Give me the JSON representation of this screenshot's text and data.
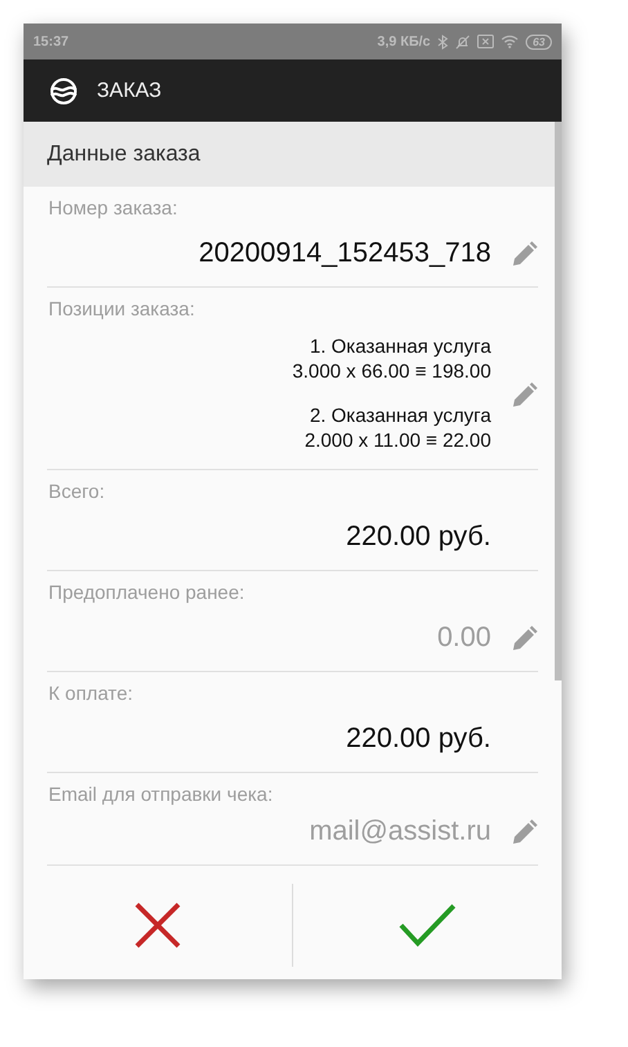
{
  "status_bar": {
    "time": "15:37",
    "speed": "3,9 КБ/с",
    "battery": "63"
  },
  "app_bar": {
    "title": "ЗАКАЗ"
  },
  "section": {
    "title": "Данные заказа"
  },
  "order_number": {
    "label": "Номер заказа:",
    "value": "20200914_152453_718",
    "editable": true
  },
  "positions": {
    "label": "Позиции заказа:",
    "items": [
      {
        "name": "1. Оказанная услуга",
        "calc": "3.000 x 66.00 ≡ 198.00"
      },
      {
        "name": "2. Оказанная услуга",
        "calc": "2.000 x 11.00 ≡ 22.00"
      }
    ],
    "editable": true
  },
  "fields": [
    {
      "label": "Всего:",
      "value": "220.00 руб.",
      "editable": false,
      "muted": false
    },
    {
      "label": "Предоплачено ранее:",
      "value": "0.00",
      "editable": true,
      "muted": true
    },
    {
      "label": "К оплате:",
      "value": "220.00 руб.",
      "editable": false,
      "muted": false
    },
    {
      "label": "Email для отправки чека:",
      "value": "mail@assist.ru",
      "editable": true,
      "muted": true
    }
  ]
}
